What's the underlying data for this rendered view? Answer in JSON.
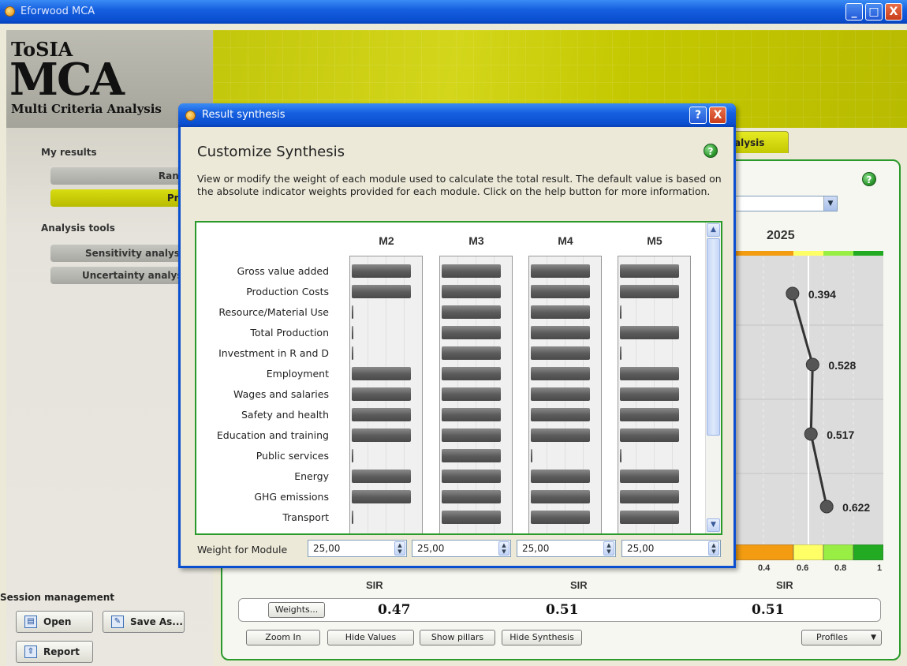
{
  "window": {
    "title": "Eforwood MCA",
    "minimize": "_",
    "maximize": "□",
    "close": "X"
  },
  "logo": {
    "line1": "ToSIA",
    "line2": "MCA",
    "line3": "Multi Criteria Analysis"
  },
  "sidebar": {
    "my_results": "My results",
    "ranking": "Ranking",
    "profile": "Profile",
    "analysis_tools": "Analysis tools",
    "sensitivity": "Sensitivity analysis",
    "uncertainty": "Uncertainty analysis",
    "session_management": "Session management",
    "open": "Open",
    "save_as": "Save As...",
    "report": "Report"
  },
  "content": {
    "tab_partial": "alysis",
    "year": "2025",
    "profile_values": [
      0.394,
      0.528,
      0.517,
      0.622
    ],
    "scale_labels": [
      "0.4",
      "0.6",
      "0.8",
      "1"
    ],
    "scale_colors": [
      "#f39c12",
      "#ffff66",
      "#99ee44",
      "#22aa22"
    ],
    "sir_labels": [
      "SIR",
      "SIR",
      "SIR"
    ],
    "weights_button": "Weights...",
    "sir_values": [
      "0.47",
      "0.51",
      "0.51"
    ],
    "zoom_in": "Zoom In",
    "hide_values": "Hide Values",
    "show_pillars": "Show pillars",
    "hide_synthesis": "Hide Synthesis",
    "profiles": "Profiles"
  },
  "dialog": {
    "title": "Result synthesis",
    "help": "?",
    "close": "X",
    "heading": "Customize Synthesis",
    "description": "View or modify the weight of each module used to calculate the total result. The default value is based on the absolute indicator weights provided for each module. Click on the help button for more information.",
    "modules": [
      "M2",
      "M3",
      "M4",
      "M5"
    ],
    "indicators": [
      "Gross value added",
      "Production Costs",
      "Resource/Material Use",
      "Total Production",
      "Investment in R and D",
      "Employment",
      "Wages and salaries",
      "Safety and health",
      "Education and training",
      "Public services",
      "Energy",
      "GHG emissions",
      "Transport"
    ],
    "bar_levels": [
      [
        0.82,
        0.82,
        0.0,
        0.0,
        0.0,
        0.82,
        0.82,
        0.82,
        0.82,
        0.0,
        0.82,
        0.82,
        0.0
      ],
      [
        0.82,
        0.82,
        0.82,
        0.82,
        0.82,
        0.82,
        0.82,
        0.82,
        0.82,
        0.82,
        0.82,
        0.82,
        0.82
      ],
      [
        0.82,
        0.82,
        0.82,
        0.82,
        0.82,
        0.82,
        0.82,
        0.82,
        0.82,
        0.0,
        0.82,
        0.82,
        0.82
      ],
      [
        0.82,
        0.82,
        0.0,
        0.82,
        0.0,
        0.82,
        0.82,
        0.82,
        0.82,
        0.0,
        0.82,
        0.82,
        0.82
      ]
    ],
    "weight_label": "Weight for Module",
    "weights": [
      "25,00",
      "25,00",
      "25,00",
      "25,00"
    ]
  }
}
